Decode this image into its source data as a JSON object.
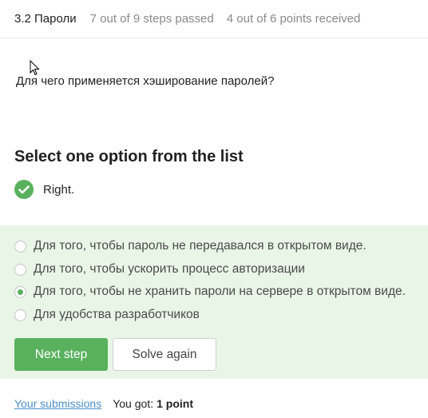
{
  "header": {
    "lesson_title": "3.2 Пароли",
    "steps_passed": "7 out of 9 steps passed",
    "points": "4 out of 6 points  received"
  },
  "question": "Для чего применяется хэширование паролей?",
  "select_heading": "Select one option from the list",
  "result": {
    "text": "Right.",
    "icon": "check-icon",
    "color": "#59b15e"
  },
  "options": [
    {
      "label": "Для того, чтобы пароль не передавался в открытом виде.",
      "selected": false
    },
    {
      "label": "Для того, чтобы ускорить процесс авторизации",
      "selected": false
    },
    {
      "label": "Для того, чтобы не хранить пароли на сервере в открытом виде.",
      "selected": true
    },
    {
      "label": "Для удобства разработчиков",
      "selected": false
    }
  ],
  "buttons": {
    "next_step": "Next step",
    "solve_again": "Solve again"
  },
  "footer": {
    "submissions_link": "Your submissions",
    "you_got": "You got:",
    "score": "1 point"
  },
  "colors": {
    "accent": "#59b15e",
    "panel_bg": "#e9f6e7",
    "link": "#4a90c9"
  }
}
